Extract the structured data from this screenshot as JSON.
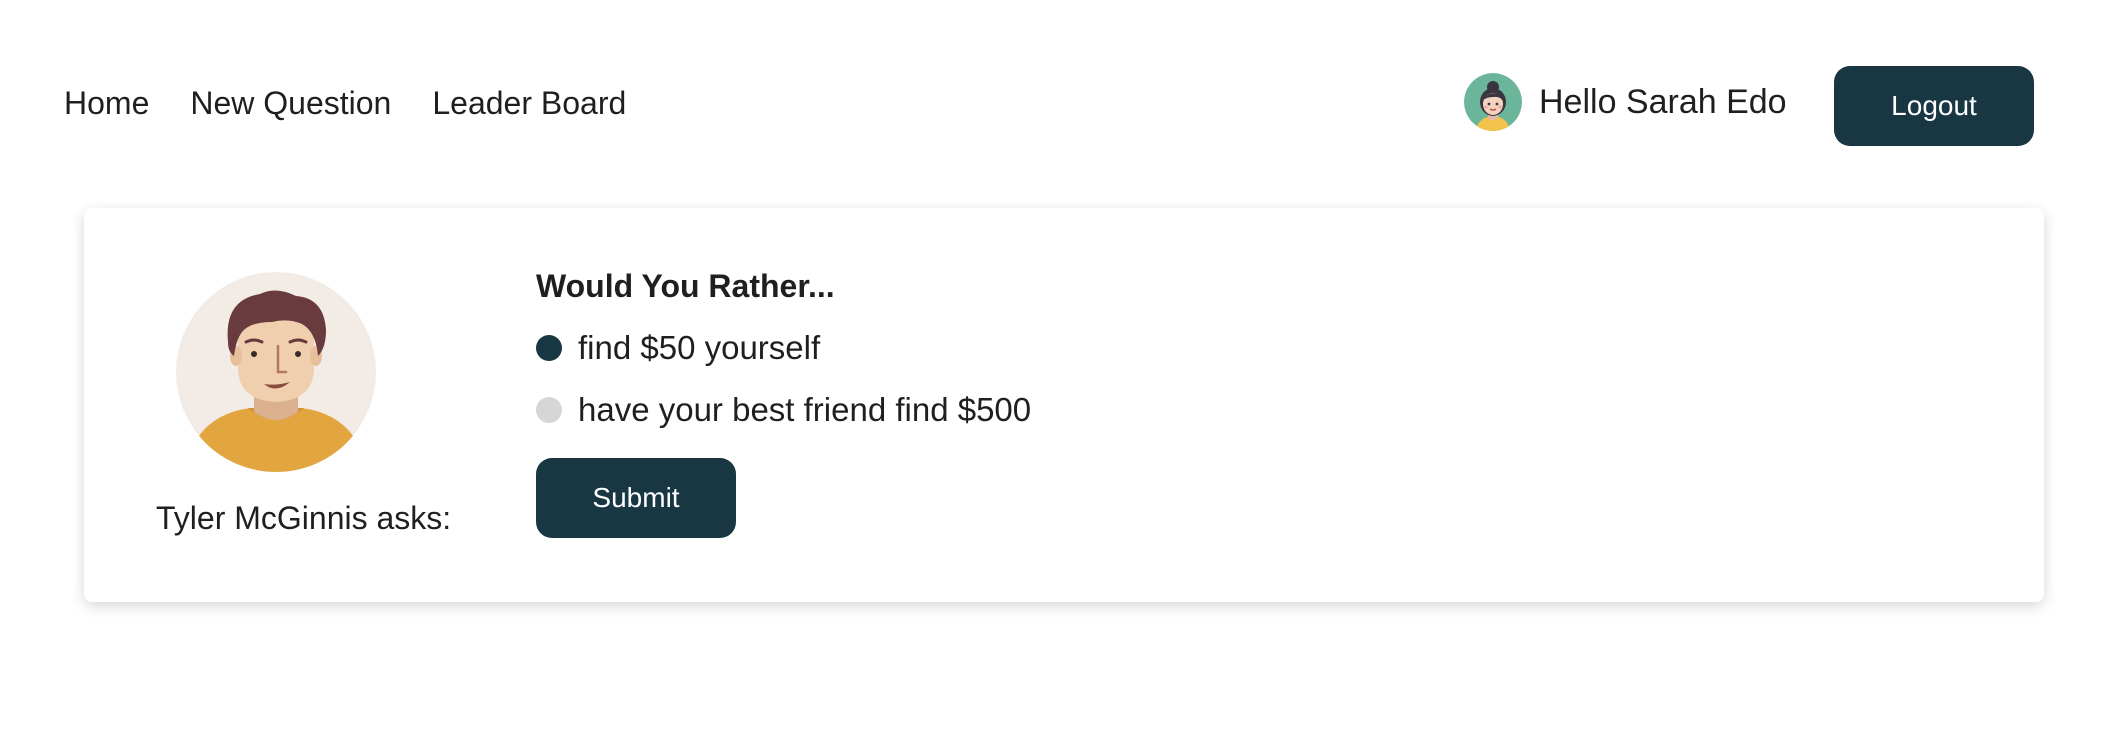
{
  "nav": {
    "links": [
      {
        "label": "Home"
      },
      {
        "label": "New Question"
      },
      {
        "label": "Leader Board"
      }
    ],
    "user": {
      "greeting": "Hello Sarah Edo",
      "avatar_icon": "female-avatar-icon"
    },
    "logout_label": "Logout"
  },
  "question": {
    "asker": "Tyler McGinnis asks:",
    "asker_avatar_icon": "male-avatar-icon",
    "title": "Would You Rather...",
    "options": [
      {
        "text": "find $50 yourself",
        "selected": true
      },
      {
        "text": "have your best friend find $500",
        "selected": false
      }
    ],
    "submit_label": "Submit"
  },
  "colors": {
    "primary": "#183742",
    "radio_unchecked": "#d6d6d6",
    "text": "#1f1f1f"
  }
}
